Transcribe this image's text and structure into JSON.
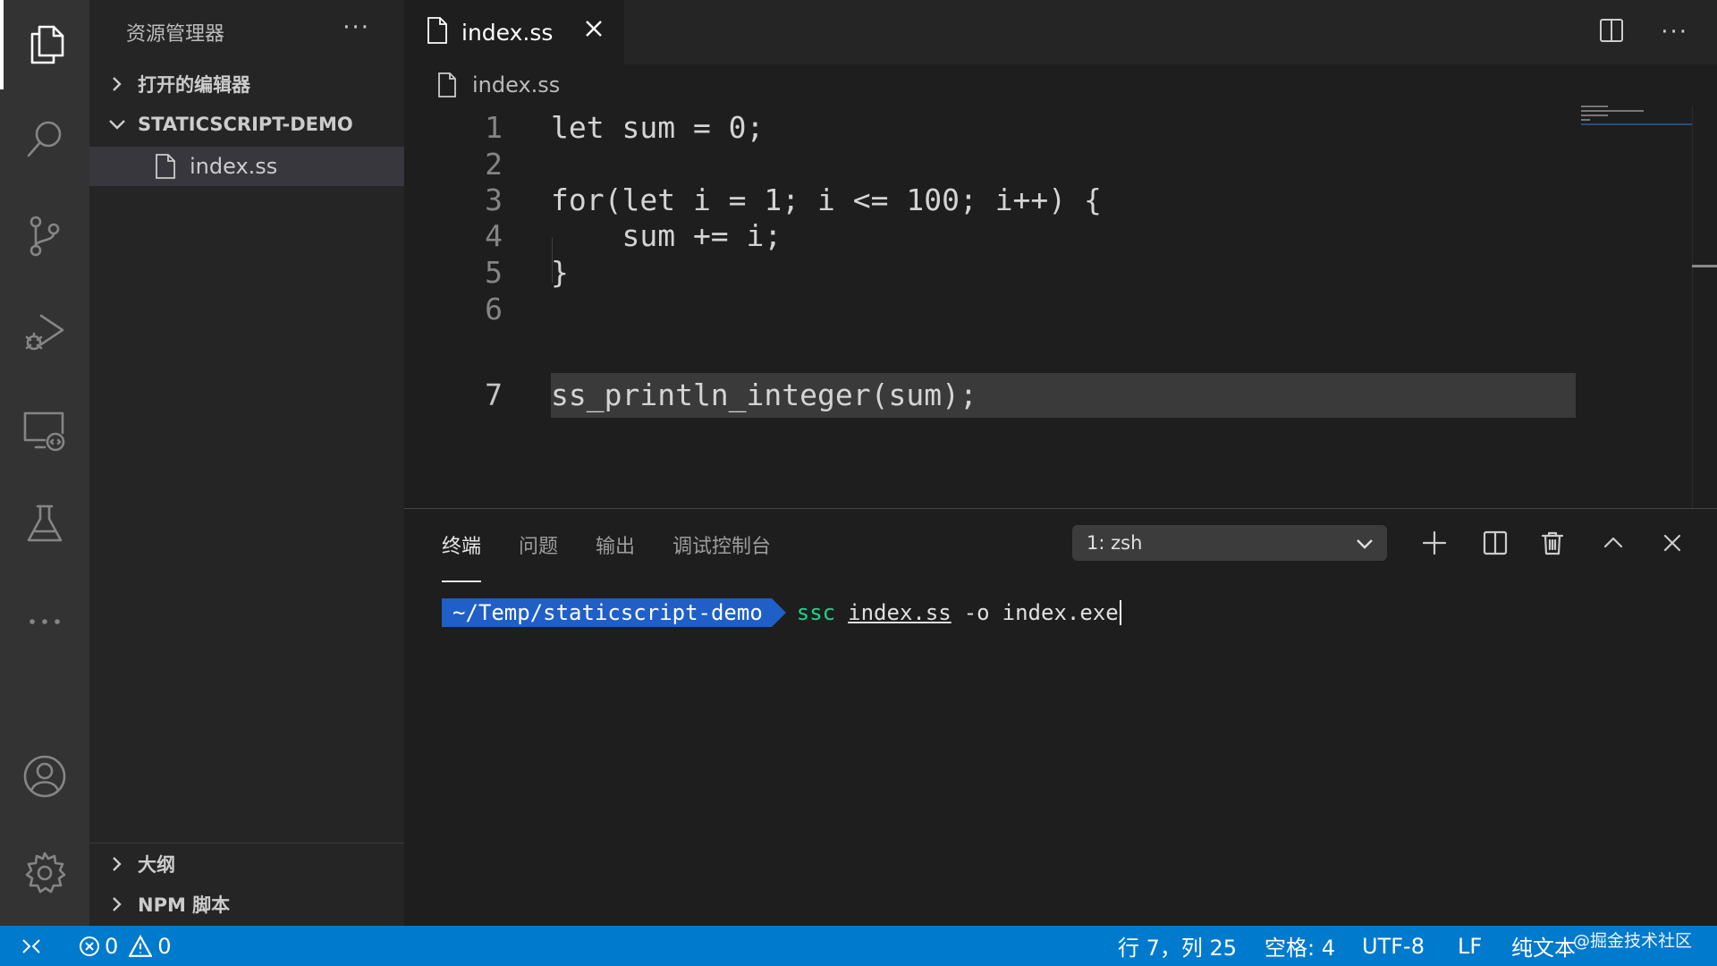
{
  "activity_bar": {
    "items": [
      "explorer",
      "search",
      "source-control",
      "run-debug",
      "remote-explorer",
      "testing",
      "more"
    ],
    "bottom": [
      "accounts",
      "manage"
    ]
  },
  "sidebar": {
    "title": "资源管理器",
    "more": "···",
    "sections": {
      "open_editors": "打开的编辑器",
      "project": "STATICSCRIPT-DEMO",
      "outline": "大纲",
      "npm": "NPM 脚本"
    },
    "files": [
      "index.ss"
    ]
  },
  "editor": {
    "tab_label": "index.ss",
    "breadcrumb": "index.ss",
    "more": "···",
    "line_numbers": [
      "1",
      "2",
      "3",
      "4",
      "5",
      "6",
      "7"
    ],
    "lines": [
      "let sum = 0;",
      "",
      "for(let i = 1; i <= 100; i++) {",
      "    sum += i;",
      "}",
      "",
      "ss_println_integer(sum);"
    ],
    "current_line": 7
  },
  "panel": {
    "tabs": [
      "终端",
      "问题",
      "输出",
      "调试控制台"
    ],
    "active_tab": "终端",
    "terminal_select": "1: zsh",
    "terminal": {
      "prompt": "~/Temp/staticscript-demo",
      "command": "ssc",
      "arg1": "index.ss",
      "arg2": "-o",
      "arg3": "index.exe"
    }
  },
  "status_bar": {
    "errors": "0",
    "warnings": "0",
    "position": "行 7，列 25",
    "indent": "空格: 4",
    "encoding": "UTF-8",
    "eol": "LF",
    "language": "纯文本",
    "watermark": "@掘金技术社区"
  },
  "colors": {
    "status_bar": "#007acc",
    "prompt_bg": "#1f5fc7",
    "command": "#23d18b"
  }
}
